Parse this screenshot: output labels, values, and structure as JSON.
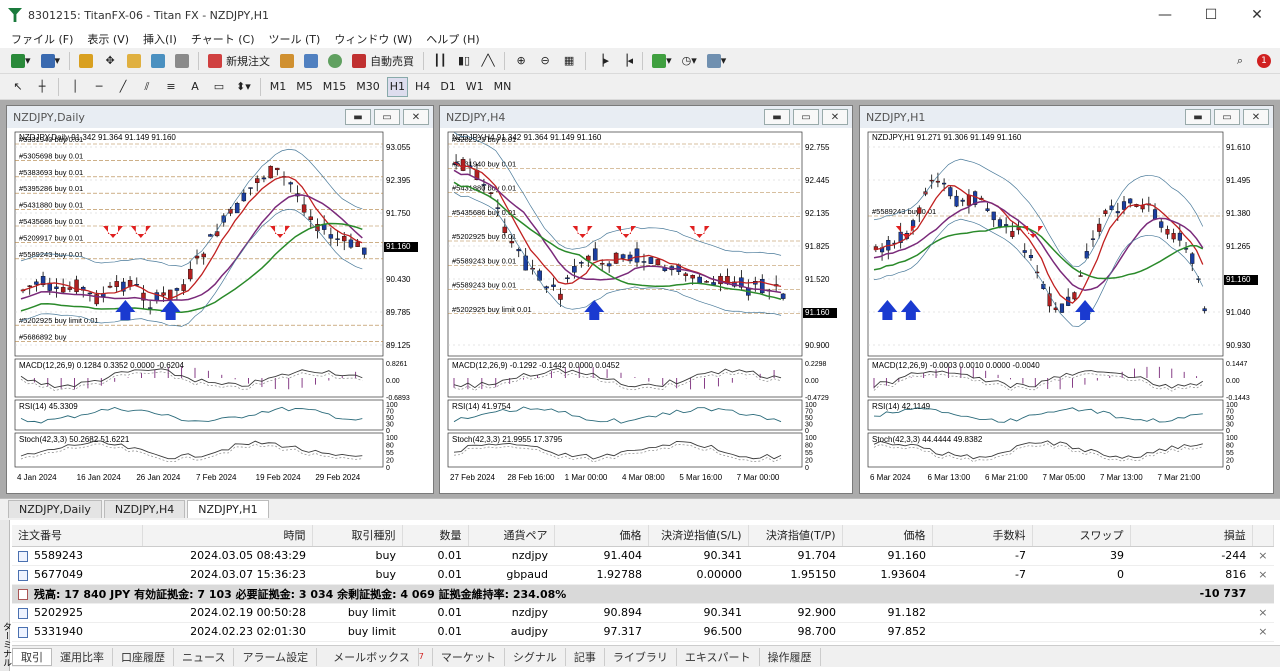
{
  "window": {
    "title": "8301215: TitanFX-06 - Titan FX - NZDJPY,H1",
    "notif_badge": "1"
  },
  "menu": [
    "ファイル (F)",
    "表示 (V)",
    "挿入(I)",
    "チャート (C)",
    "ツール (T)",
    "ウィンドウ (W)",
    "ヘルプ (H)"
  ],
  "toolbar": {
    "new_order": "新規注文",
    "auto_trade": "自動売買"
  },
  "periods": [
    "M1",
    "M5",
    "M15",
    "M30",
    "H1",
    "H4",
    "D1",
    "W1",
    "MN"
  ],
  "active_period": "H1",
  "charts": [
    {
      "window_title": "NZDJPY,Daily",
      "info": "NZDJPY,Daily  91.342 91.364 91.149 91.160",
      "price_labels": [
        "93.055",
        "92.395",
        "91.750",
        "91.160",
        "90.430",
        "89.785",
        "89.125"
      ],
      "current_price": "91.160",
      "order_labels": [
        "#5331940 buy 0.01",
        "#5305698 buy 0.01",
        "#5383693 buy 0.01",
        "#5395286 buy 0.01",
        "#5431880 buy 0.01",
        "#5435686 buy 0.01",
        "#5209917 buy 0.01",
        "#5589243 buy 0.01",
        "#5202925 buy limit 0.01",
        "#5686892 buy"
      ],
      "dates": [
        "4 Jan 2024",
        "16 Jan 2024",
        "26 Jan 2024",
        "7 Feb 2024",
        "19 Feb 2024",
        "29 Feb 2024"
      ],
      "macd": {
        "label": "MACD(12,26,9) 0.1284 0.3352 0.0000 -0.6204",
        "levels": [
          "0.8261",
          "0.00",
          "-0.6893"
        ]
      },
      "rsi": {
        "label": "RSI(14) 45.3309",
        "levels": [
          "100",
          "70",
          "50",
          "30",
          "0"
        ]
      },
      "stoch": {
        "label": "Stoch(42,3,3) 50.2682 51.6221",
        "levels": [
          "100",
          "80",
          "55",
          "20",
          "0"
        ]
      }
    },
    {
      "window_title": "NZDJPY,H4",
      "info": "NZDJPY,H4  91.342 91.364 91.149 91.160",
      "price_labels": [
        "92.755",
        "92.445",
        "92.135",
        "91.825",
        "91.520",
        "91.160",
        "90.900"
      ],
      "current_price": "91.160",
      "order_labels": [
        "#5202925 buy 0.01",
        "#5331940 buy 0.01",
        "#5431880 buy 0.01",
        "#5435686 buy 0.01",
        "#5202925 buy 0.01",
        "#5589243 buy 0.01",
        "#5589243 buy 0.01",
        "#5202925 buy limit 0.01"
      ],
      "dates": [
        "27 Feb 2024",
        "28 Feb 16:00",
        "1 Mar 00:00",
        "4 Mar 08:00",
        "5 Mar 16:00",
        "7 Mar 00:00"
      ],
      "macd": {
        "label": "MACD(12,26,9) -0.1292 -0.1442 0.0000 0.0452",
        "levels": [
          "0.2298",
          "0.00",
          "-0.4729"
        ]
      },
      "rsi": {
        "label": "RSI(14) 41.9754",
        "levels": [
          "100",
          "70",
          "50",
          "30",
          "0"
        ]
      },
      "stoch": {
        "label": "Stoch(42,3,3) 21.9955 17.3795",
        "levels": [
          "100",
          "80",
          "55",
          "20",
          "0"
        ]
      }
    },
    {
      "window_title": "NZDJPY,H1",
      "info": "NZDJPY,H1  91.271 91.306 91.149 91.160",
      "price_labels": [
        "91.610",
        "91.495",
        "91.380",
        "91.265",
        "91.160",
        "91.040",
        "90.930"
      ],
      "current_price": "91.160",
      "order_labels": [
        "#5589243 buy 0.01"
      ],
      "dates": [
        "6 Mar 2024",
        "6 Mar 13:00",
        "6 Mar 21:00",
        "7 Mar 05:00",
        "7 Mar 13:00",
        "7 Mar 21:00"
      ],
      "macd": {
        "label": "MACD(12,26,9) -0.0003 0.0010 0.0000 -0.0040",
        "levels": [
          "0.1447",
          "0.00",
          "-0.1443"
        ]
      },
      "rsi": {
        "label": "RSI(14) 42.1149",
        "levels": [
          "100",
          "70",
          "50",
          "30",
          "0"
        ]
      },
      "stoch": {
        "label": "Stoch(42,3,3) 44.4444 49.8382",
        "levels": [
          "100",
          "80",
          "55",
          "20",
          "0"
        ]
      }
    }
  ],
  "chart_tabs": [
    "NZDJPY,Daily",
    "NZDJPY,H4",
    "NZDJPY,H1"
  ],
  "active_chart_tab": "NZDJPY,H1",
  "terminal": {
    "side_label": "ターミナル",
    "columns": [
      "注文番号",
      "時間",
      "取引種別",
      "数量",
      "通貨ペア",
      "価格",
      "決済逆指値(S/L)",
      "決済指値(T/P)",
      "価格",
      "手数料",
      "スワップ",
      "損益"
    ],
    "rows": [
      [
        "5589243",
        "2024.03.05 08:43:29",
        "buy",
        "0.01",
        "nzdjpy",
        "91.404",
        "90.341",
        "91.704",
        "91.160",
        "-7",
        "39",
        "-244"
      ],
      [
        "5677049",
        "2024.03.07 15:36:23",
        "buy",
        "0.01",
        "gbpaud",
        "1.92788",
        "0.00000",
        "1.95150",
        "1.93604",
        "-7",
        "0",
        "816"
      ]
    ],
    "balance_text": "残高: 17 840 JPY  有効証拠金: 7 103  必要証拠金: 3 034  余剰証拠金: 4 069  証拠金維持率: 234.08%",
    "balance_pl": "-10 737",
    "pending": [
      [
        "5202925",
        "2024.02.19 00:50:28",
        "buy limit",
        "0.01",
        "nzdjpy",
        "90.894",
        "90.341",
        "92.900",
        "91.182",
        "",
        "",
        ""
      ],
      [
        "5331940",
        "2024.02.23 02:01:30",
        "buy limit",
        "0.01",
        "audjpy",
        "97.317",
        "96.500",
        "98.700",
        "97.852",
        "",
        "",
        ""
      ]
    ]
  },
  "bottom_tabs": [
    "取引",
    "運用比率",
    "口座履歴",
    "ニュース",
    "アラーム設定",
    "メールボックス",
    "マーケット",
    "シグナル",
    "記事",
    "ライブラリ",
    "エキスパート",
    "操作履歴"
  ],
  "mailbox_badge": "7"
}
